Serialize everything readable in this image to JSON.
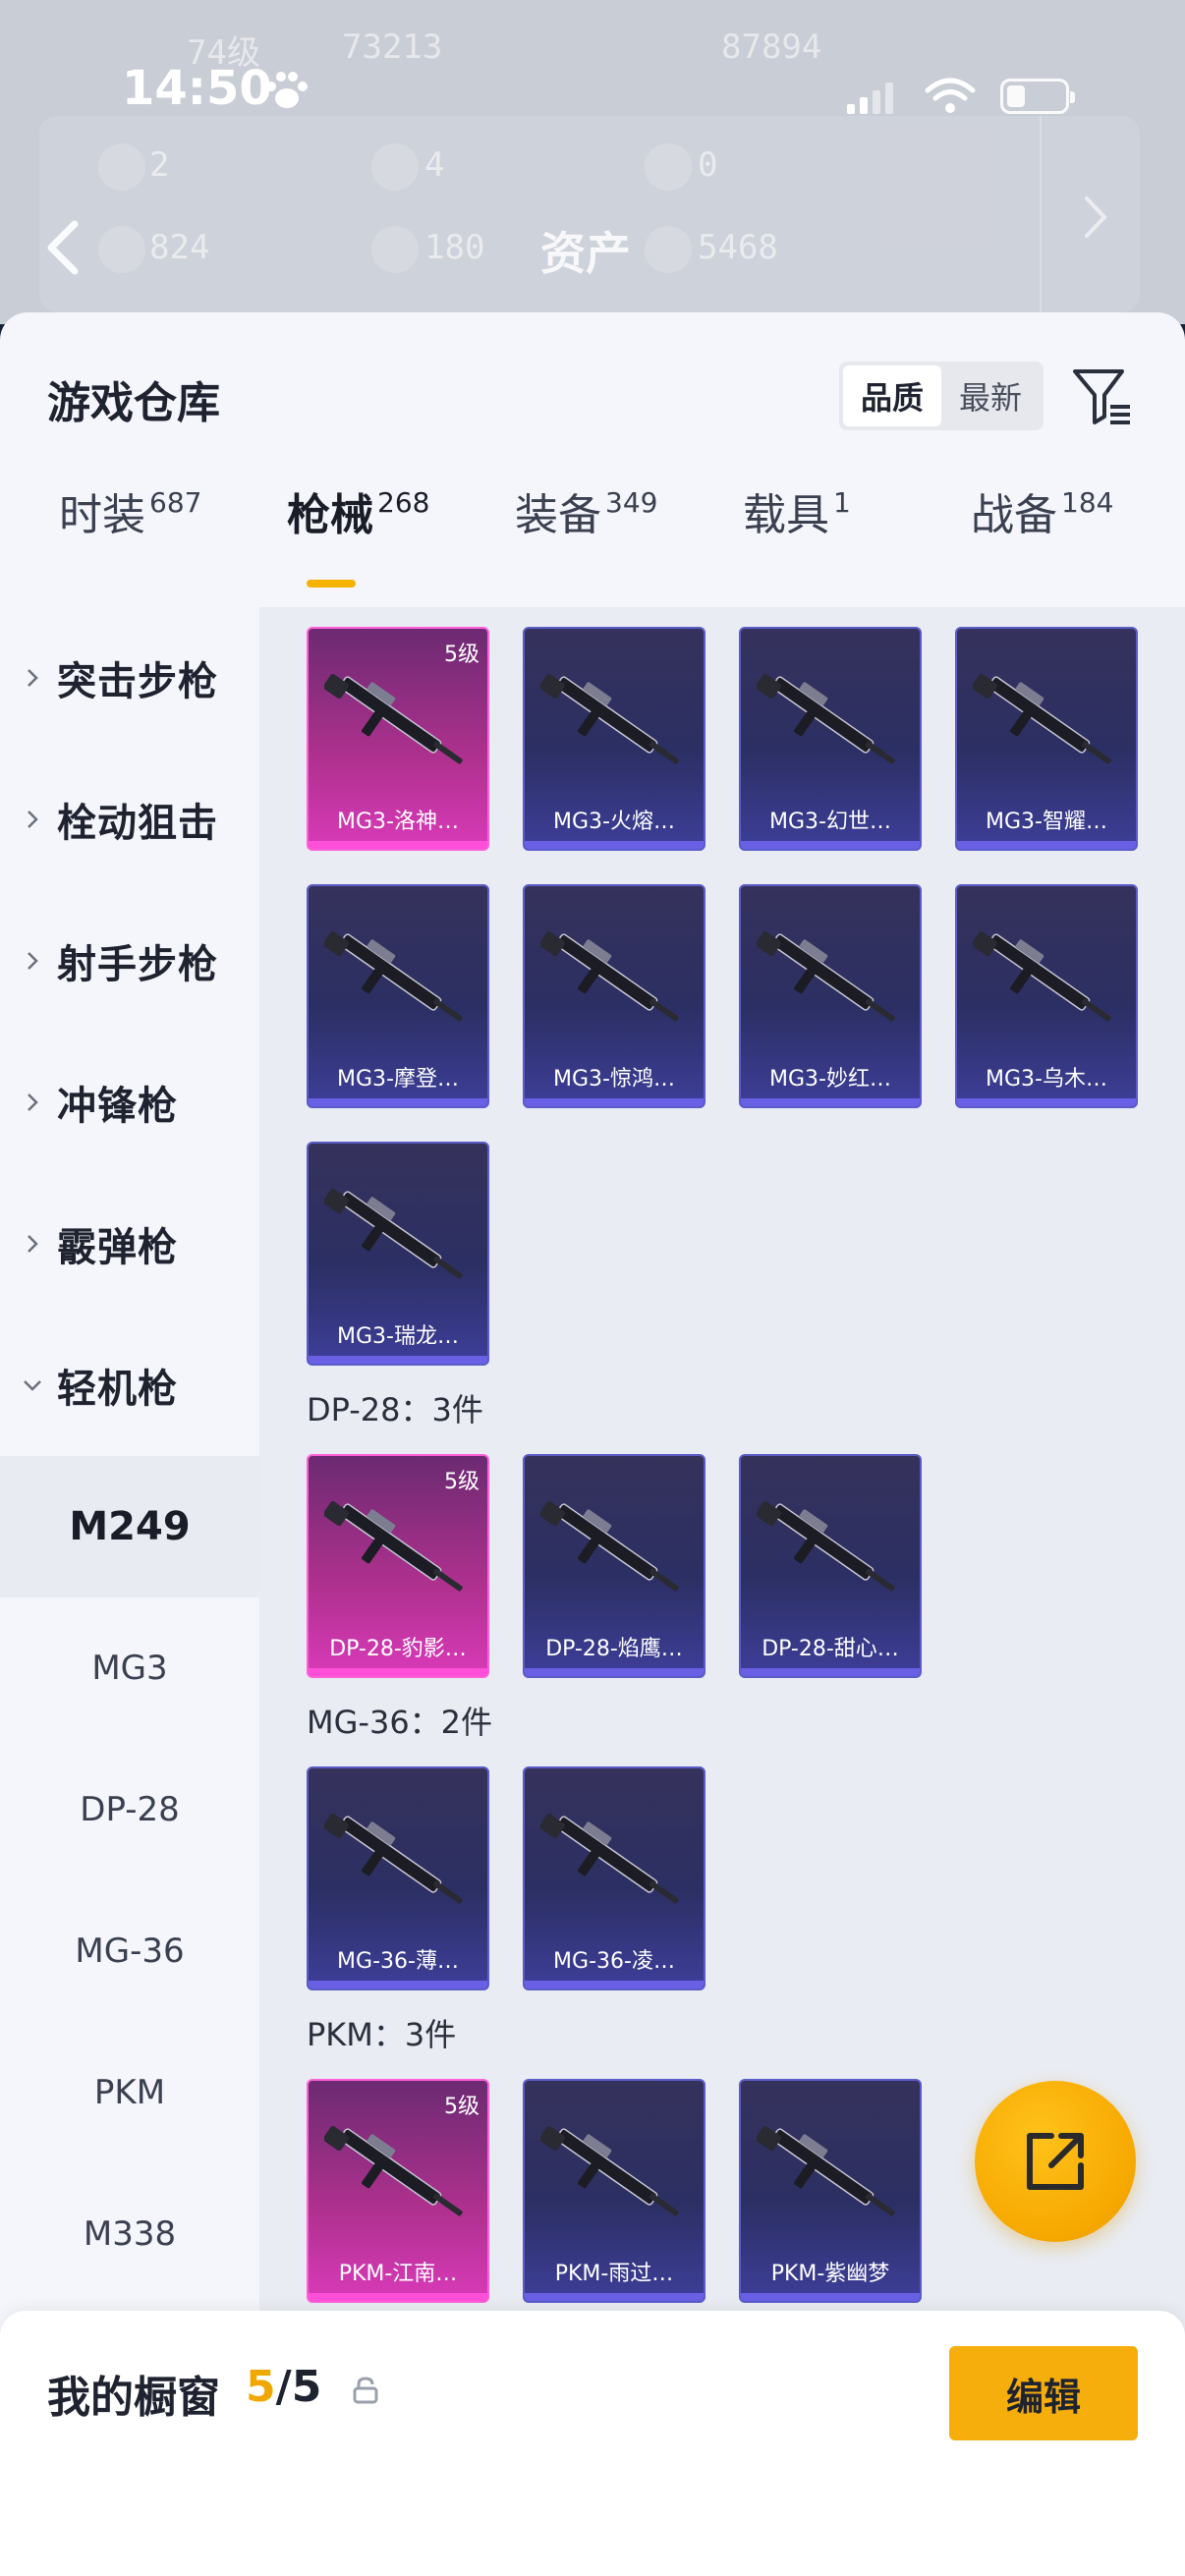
{
  "status_bar": {
    "time": "14:50"
  },
  "background_header": {
    "ghost_level": "74级",
    "ghost_views": "73213",
    "ghost_score": "87894",
    "ghost_stat_1": "2",
    "ghost_stat_2": "4",
    "ghost_stat_3": "0",
    "ghost_stat_4": "824",
    "ghost_stat_5": "180",
    "ghost_stat_6": "5468",
    "title": "资产"
  },
  "sheet": {
    "title": "游戏仓库",
    "sort_options": [
      "品质",
      "最新"
    ],
    "active_sort": "品质"
  },
  "tabs": [
    {
      "label": "时装",
      "count": "687",
      "active": false
    },
    {
      "label": "枪械",
      "count": "268",
      "active": true
    },
    {
      "label": "装备",
      "count": "349",
      "active": false
    },
    {
      "label": "载具",
      "count": "1",
      "active": false
    },
    {
      "label": "战备",
      "count": "184",
      "active": false
    }
  ],
  "sidebar": {
    "categories": [
      "突击步枪",
      "栓动狙击",
      "射手步枪",
      "冲锋枪",
      "霰弹枪",
      "轻机枪"
    ],
    "expanded": "轻机枪",
    "subcategories": [
      "M249",
      "MG3",
      "DP-28",
      "MG-36",
      "PKM",
      "M338"
    ],
    "active_sub": "M249"
  },
  "groups": [
    {
      "header": "",
      "items": [
        {
          "name": "MG3-洛神…",
          "level": "5级",
          "rarity": "legend"
        },
        {
          "name": "MG3-火熔…",
          "level": "",
          "rarity": "epic"
        },
        {
          "name": "MG3-幻世…",
          "level": "",
          "rarity": "epic"
        },
        {
          "name": "MG3-智耀…",
          "level": "",
          "rarity": "epic"
        },
        {
          "name": "MG3-摩登…",
          "level": "",
          "rarity": "epic"
        },
        {
          "name": "MG3-惊鸿…",
          "level": "",
          "rarity": "epic"
        },
        {
          "name": "MG3-妙红…",
          "level": "",
          "rarity": "epic"
        },
        {
          "name": "MG3-乌木…",
          "level": "",
          "rarity": "epic"
        },
        {
          "name": "MG3-瑞龙…",
          "level": "",
          "rarity": "epic"
        }
      ]
    },
    {
      "header": "DP-28：3件",
      "items": [
        {
          "name": "DP-28-豹影…",
          "level": "5级",
          "rarity": "legend"
        },
        {
          "name": "DP-28-焰鹰…",
          "level": "",
          "rarity": "epic"
        },
        {
          "name": "DP-28-甜心…",
          "level": "",
          "rarity": "epic"
        }
      ]
    },
    {
      "header": "MG-36：2件",
      "items": [
        {
          "name": "MG-36-薄…",
          "level": "",
          "rarity": "epic"
        },
        {
          "name": "MG-36-凌…",
          "level": "",
          "rarity": "epic"
        }
      ]
    },
    {
      "header": "PKM：3件",
      "items": [
        {
          "name": "PKM-江南…",
          "level": "5级",
          "rarity": "legend"
        },
        {
          "name": "PKM-雨过…",
          "level": "",
          "rarity": "epic"
        },
        {
          "name": "PKM-紫幽梦",
          "level": "",
          "rarity": "epic"
        }
      ]
    }
  ],
  "showcase": {
    "label": "我的橱窗",
    "current": "5",
    "separator": "/",
    "max": "5",
    "edit_label": "编辑"
  },
  "colors": {
    "accent": "#f6ae0c",
    "legend": "#d93ab9",
    "epic": "#3d3e99"
  }
}
